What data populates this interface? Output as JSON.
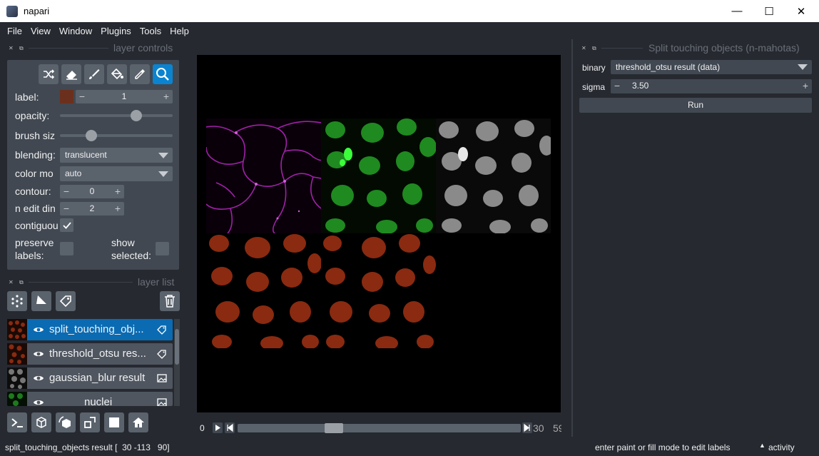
{
  "window": {
    "title": "napari",
    "minimize": "—",
    "maximize": "☐",
    "close": "✕"
  },
  "menu": [
    "File",
    "View",
    "Window",
    "Plugins",
    "Tools",
    "Help"
  ],
  "layer_controls": {
    "title": "layer controls",
    "tools": [
      "shuffle-icon",
      "eraser-icon",
      "brush-icon",
      "fill-icon",
      "picker-icon",
      "zoom-icon"
    ],
    "label_label": "label:",
    "label_value": "1",
    "label_color": "#6b2f1d",
    "opacity_label": "opacity:",
    "opacity_value": 0.7,
    "brush_size_label": "brush siz",
    "brush_size_value": 0.25,
    "blending_label": "blending:",
    "blending_value": "translucent",
    "color_mode_label": "color mo",
    "color_mode_value": "auto",
    "contour_label": "contour:",
    "contour_value": "0",
    "n_edit_dim_label": "n edit din",
    "n_edit_dim_value": "2",
    "contiguous_label": "contiguou",
    "contiguous_checked": true,
    "preserve_labels_label_1": "preserve",
    "preserve_labels_label_2": "labels:",
    "show_selected_label_1": "show",
    "show_selected_label_2": "selected:"
  },
  "layer_list": {
    "title": "layer list",
    "layers": [
      {
        "name": "split_touching_obj...",
        "type": "labels",
        "selected": true
      },
      {
        "name": "threshold_otsu res...",
        "type": "labels",
        "selected": false
      },
      {
        "name": "gaussian_blur result",
        "type": "image",
        "selected": false
      },
      {
        "name": "nuclei",
        "type": "image",
        "selected": false
      }
    ]
  },
  "dims": {
    "current": "0",
    "right_label_1": "30",
    "right_label_2": "59",
    "position": 0.33
  },
  "plugin_panel": {
    "title": "Split touching objects (n-mahotas)",
    "binary_label": "binary",
    "binary_value": "threshold_otsu result (data)",
    "sigma_label": "sigma",
    "sigma_value": "3.50",
    "run_label": "Run"
  },
  "status": {
    "left": "split_touching_objects result [  30 -113   90]",
    "hint": "enter paint or fill mode to edit labels",
    "activity": "activity"
  },
  "colors": {
    "accent": "#0a84d0",
    "background": "#262930",
    "panel": "#414851",
    "labels": "#8a2a10"
  }
}
